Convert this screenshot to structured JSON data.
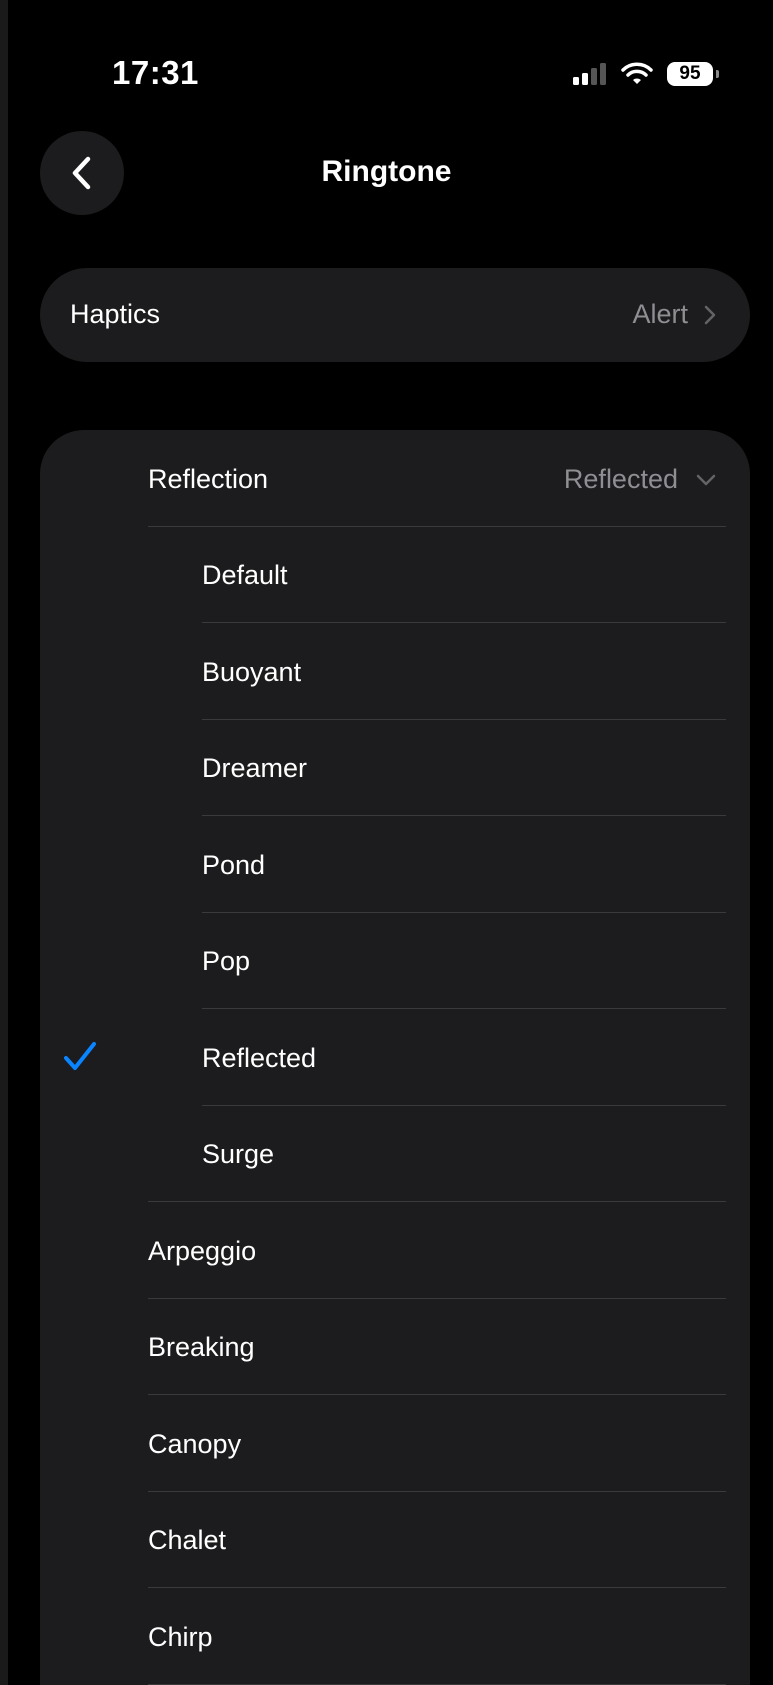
{
  "status_bar": {
    "time": "17:31",
    "battery": "95"
  },
  "nav": {
    "title": "Ringtone",
    "back_icon": "chevron-left-icon"
  },
  "haptics": {
    "label": "Haptics",
    "value": "Alert"
  },
  "section": {
    "label": "Reflection",
    "value": "Reflected",
    "expanded": true
  },
  "sub_items": [
    "Default",
    "Buoyant",
    "Dreamer",
    "Pond",
    "Pop",
    "Reflected",
    "Surge"
  ],
  "selected_sub_item": "Reflected",
  "items": [
    "Arpeggio",
    "Breaking",
    "Canopy",
    "Chalet",
    "Chirp"
  ],
  "colors": {
    "accent": "#0a84ff",
    "cell": "#1c1c1e",
    "secondary_text": "#8e8e93",
    "separator": "#3a3a3c"
  }
}
